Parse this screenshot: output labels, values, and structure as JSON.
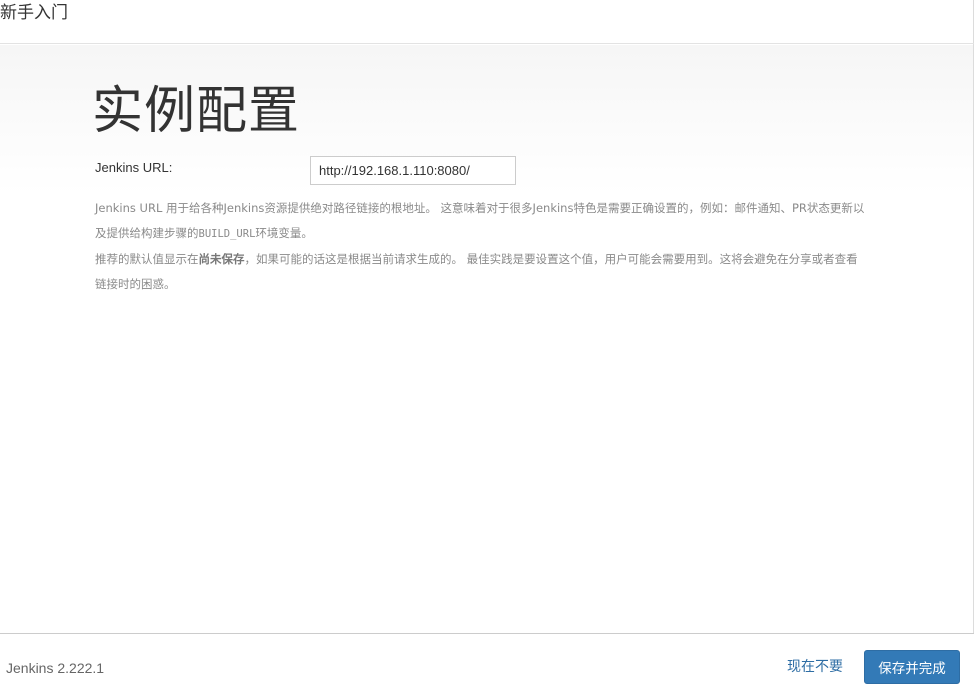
{
  "header": {
    "title": "新手入门"
  },
  "main": {
    "title": "实例配置",
    "url_label": "Jenkins URL:",
    "url_value": "http://192.168.1.110:8080/",
    "help": {
      "p1": "Jenkins URL 用于给各种Jenkins资源提供绝对路径链接的根地址。 这意味着对于很多Jenkins特色是需要正确设置的，例如：邮件通知、PR状态更新以及提供给构建步骤的",
      "p1_code": "BUILD_URL",
      "p1_end": "环境变量。",
      "p2_start": "推荐的默认值显示在",
      "p2_strong": "尚未保存",
      "p2_end": "，如果可能的话这是根据当前请求生成的。 最佳实践是要设置这个值，用户可能会需要用到。这将会避免在分享或者查看链接时的困惑。"
    }
  },
  "footer": {
    "version": "Jenkins 2.222.1",
    "skip_label": "现在不要",
    "save_label": "保存并完成"
  },
  "colors": {
    "primary_button": "#337ab7",
    "link": "#2e6da4",
    "help_text": "#8a8a8a"
  }
}
